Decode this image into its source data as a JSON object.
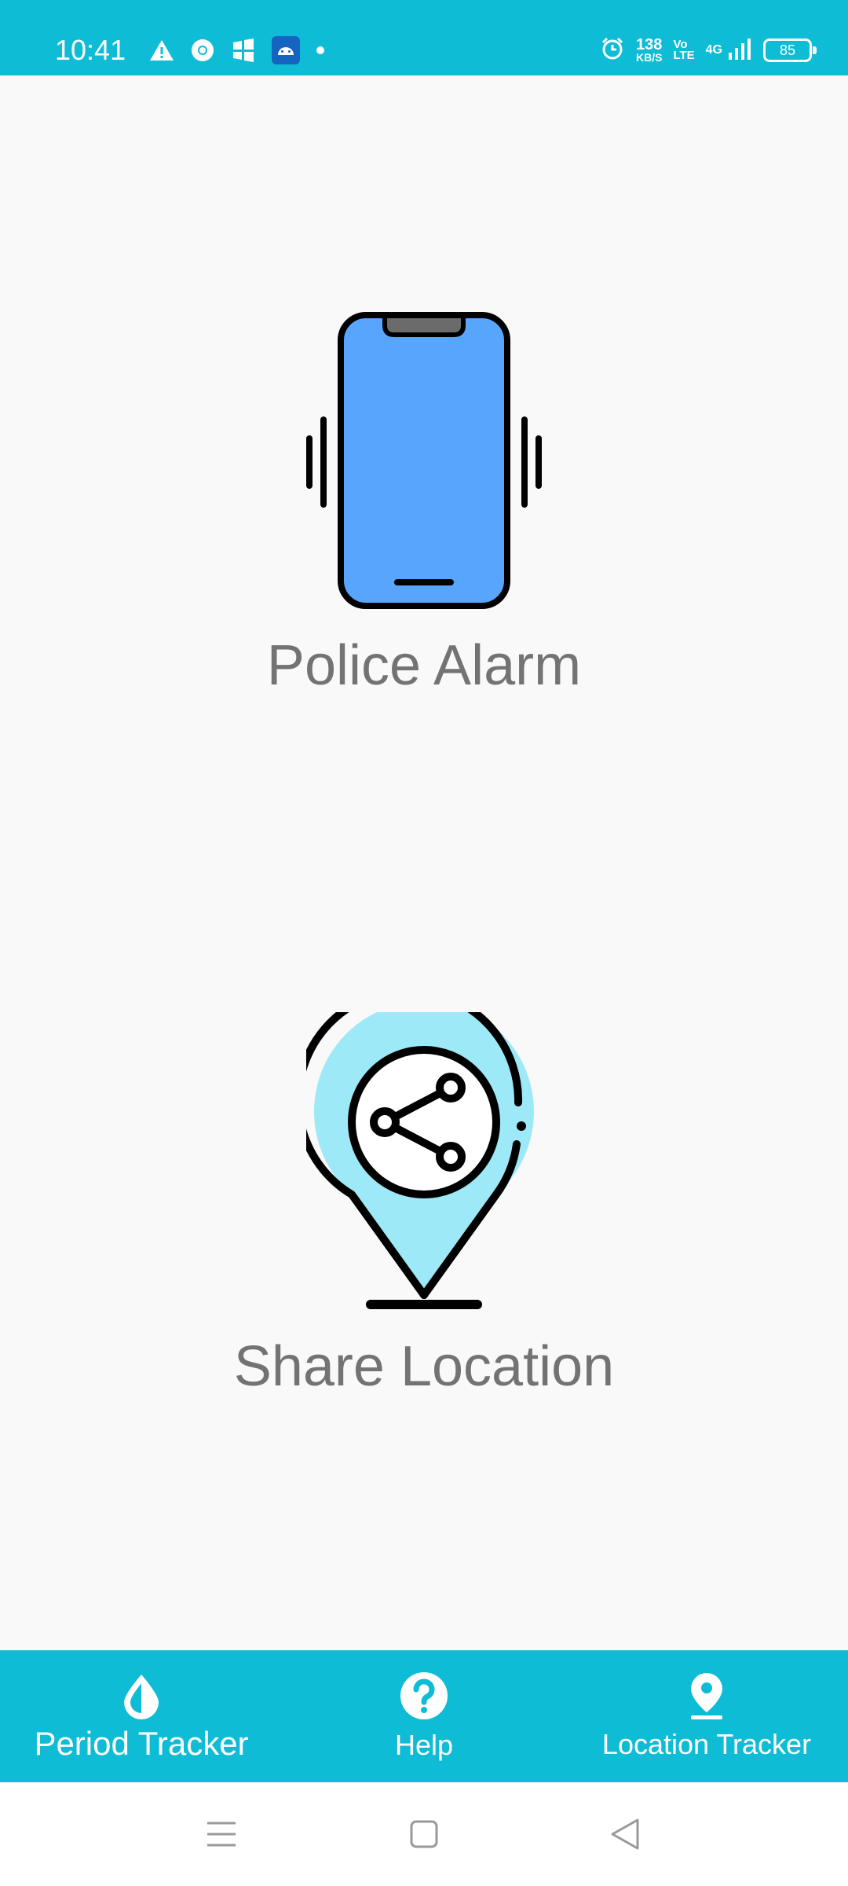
{
  "status_bar": {
    "time": "10:41",
    "net_speed_value": "138",
    "net_speed_unit": "KB/S",
    "volte_top": "Vo",
    "volte_bottom": "LTE",
    "network": "4G",
    "battery": "85",
    "icons": [
      "warning-icon",
      "chrome-icon",
      "gallery-icon",
      "android-icon",
      "dot-icon",
      "alarm-clock-icon",
      "signal-icon",
      "battery-icon"
    ]
  },
  "main": {
    "features": [
      {
        "label": "Police Alarm",
        "icon": "vibrating-phone-icon"
      },
      {
        "label": "Share Location",
        "icon": "share-location-pin-icon"
      }
    ]
  },
  "bottom_nav": {
    "items": [
      {
        "label": "Period Tracker",
        "icon": "drop-icon"
      },
      {
        "label": "Help",
        "icon": "help-icon"
      },
      {
        "label": "Location Tracker",
        "icon": "location-pin-icon"
      }
    ]
  },
  "system_nav": {
    "buttons": [
      "menu-icon",
      "home-icon",
      "back-icon"
    ]
  },
  "colors": {
    "accent": "#0fbcd6",
    "background": "#f9f9f9",
    "label_gray": "#737373",
    "phone_blue": "#57a5fd",
    "pin_light_blue": "#9de9f7"
  }
}
